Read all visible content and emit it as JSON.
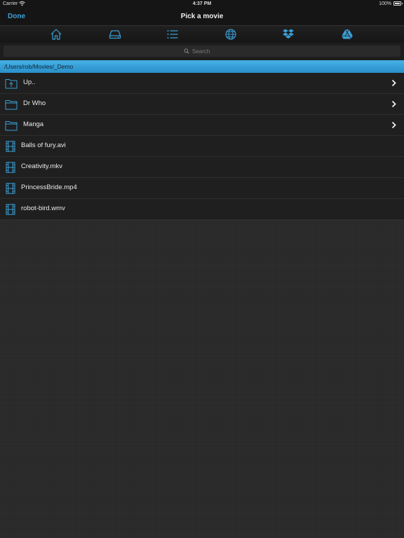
{
  "status_bar": {
    "carrier": "Carrier",
    "time": "4:37 PM",
    "battery": "100%"
  },
  "nav_bar": {
    "done_label": "Done",
    "title": "Pick a movie"
  },
  "toolbar": {
    "items": [
      {
        "icon": "home-icon"
      },
      {
        "icon": "drive-icon"
      },
      {
        "icon": "list-icon"
      },
      {
        "icon": "globe-icon"
      },
      {
        "icon": "dropbox-icon"
      },
      {
        "icon": "google-drive-icon"
      }
    ]
  },
  "search": {
    "placeholder": "Search"
  },
  "path": "/Users/rob/Movies/_Demo",
  "files": [
    {
      "name": "Up..",
      "type": "parent-folder",
      "icon": "folder-up-icon"
    },
    {
      "name": "Dr Who",
      "type": "folder",
      "icon": "folder-icon"
    },
    {
      "name": "Manga",
      "type": "folder",
      "icon": "folder-icon"
    },
    {
      "name": "Balls of fury.avi",
      "type": "movie",
      "icon": "film-icon"
    },
    {
      "name": "Creativity.mkv",
      "type": "movie",
      "icon": "film-icon"
    },
    {
      "name": "PrincessBride.mp4",
      "type": "movie",
      "icon": "film-icon"
    },
    {
      "name": "robot-bird.wmv",
      "type": "movie",
      "icon": "film-icon"
    }
  ],
  "colors": {
    "accent": "#3fa0d8",
    "path_bar": "#2a8fc8",
    "row_background": "#1f1f1f",
    "page_background": "#2a2a2a"
  }
}
